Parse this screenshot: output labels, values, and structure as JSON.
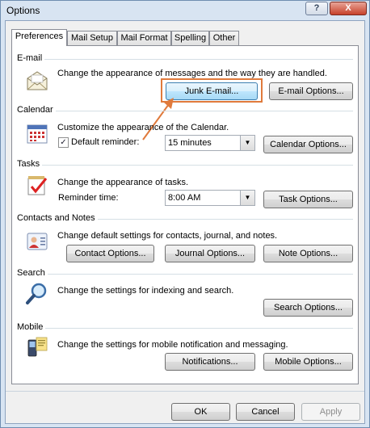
{
  "window": {
    "title": "Options",
    "help_glyph": "?",
    "close_glyph": "X"
  },
  "tabs": [
    {
      "label": "Preferences",
      "active": true
    },
    {
      "label": "Mail Setup"
    },
    {
      "label": "Mail Format"
    },
    {
      "label": "Spelling"
    },
    {
      "label": "Other"
    }
  ],
  "email": {
    "title": "E-mail",
    "description": "Change the appearance of messages and the way they are handled.",
    "junk_button": "Junk E-mail...",
    "options_button": "E-mail Options..."
  },
  "calendar": {
    "title": "Calendar",
    "description": "Customize the appearance of the Calendar.",
    "reminder_label": "Default reminder:",
    "reminder_checked": true,
    "reminder_value": "15 minutes",
    "options_button": "Calendar Options..."
  },
  "tasks": {
    "title": "Tasks",
    "description": "Change the appearance of tasks.",
    "reminder_label": "Reminder time:",
    "reminder_value": "8:00 AM",
    "options_button": "Task Options..."
  },
  "contacts": {
    "title": "Contacts and Notes",
    "description": "Change default settings for contacts, journal, and notes.",
    "contact_button": "Contact Options...",
    "journal_button": "Journal Options...",
    "note_button": "Note Options..."
  },
  "search": {
    "title": "Search",
    "description": "Change the settings for indexing and search.",
    "options_button": "Search Options..."
  },
  "mobile": {
    "title": "Mobile",
    "description": "Change the settings for mobile notification and messaging.",
    "notifications_button": "Notifications...",
    "options_button": "Mobile Options..."
  },
  "footer": {
    "ok": "OK",
    "cancel": "Cancel",
    "apply": "Apply"
  },
  "colors": {
    "highlight": "#e07a3c",
    "title_bar": "#d8e4f2"
  }
}
